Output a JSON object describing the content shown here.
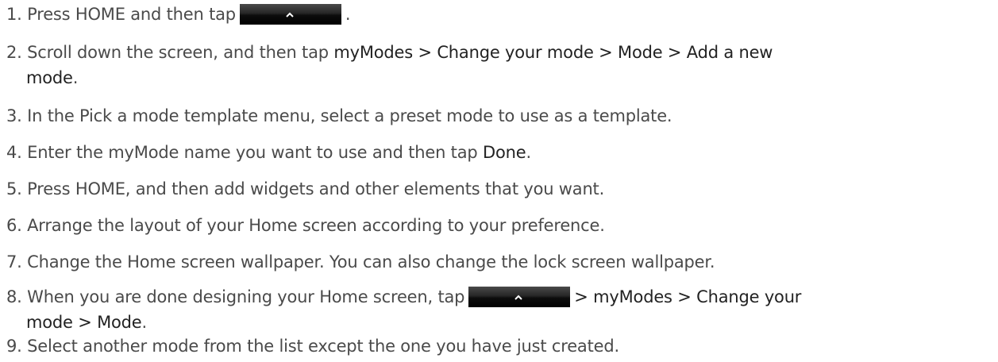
{
  "steps": [
    {
      "num": "1.",
      "pre": "Press HOME and then tap",
      "post": "."
    },
    {
      "num": "2.",
      "pre": "Scroll down the screen, and then tap",
      "bold1": "myModes > Change your mode > Mode > Add a new",
      "bold2": "mode",
      "post": "."
    },
    {
      "num": "3.",
      "text": "In the Pick a mode template menu, select a preset mode to use as a template."
    },
    {
      "num": "4.",
      "pre": "Enter the myMode name you want to use and then tap",
      "bold": "Done",
      "post": "."
    },
    {
      "num": "5.",
      "text": "Press HOME, and then add widgets and other elements that you want."
    },
    {
      "num": "6.",
      "text": "Arrange the layout of your Home screen according to your preference."
    },
    {
      "num": "7.",
      "text": "Change the Home screen wallpaper. You can also change the lock screen wallpaper."
    },
    {
      "num": "8.",
      "pre": "When you are done designing your Home screen, tap",
      "bold1": "> myModes > Change your",
      "bold2": "mode > Mode",
      "post": "."
    },
    {
      "num": "9.",
      "text": "Select another mode from the list except the one you have just created."
    }
  ],
  "icons": {
    "up_button": "chevron-up-icon"
  }
}
